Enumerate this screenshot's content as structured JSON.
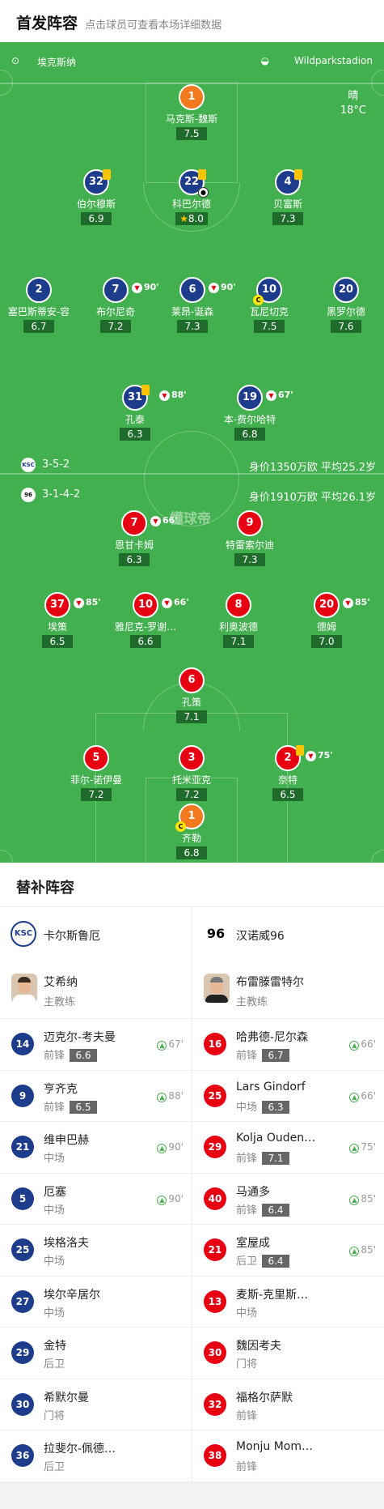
{
  "header": {
    "title": "首发阵容",
    "subtitle": "点击球员可查看本场详细数据"
  },
  "pitch": {
    "away_team": "埃克斯纳",
    "stadium": "Wildparkstadion",
    "weather": "晴",
    "temperature": "18°C",
    "watermark": "懂球帝",
    "home_formation": "3-5-2",
    "home_value": "身价1350万欧 平均25.2岁",
    "away_formation": "3-1-4-2",
    "away_value": "身价1910万欧 平均26.1岁",
    "home_players": [
      {
        "num": "1",
        "name": "马克斯-魏斯",
        "rating": "7.5"
      },
      {
        "num": "32",
        "name": "伯尔穆斯",
        "rating": "6.9"
      },
      {
        "num": "22",
        "name": "科巴尔德",
        "rating": "8.0"
      },
      {
        "num": "4",
        "name": "贝富斯",
        "rating": "7.3"
      },
      {
        "num": "2",
        "name": "塞巴斯蒂安-容",
        "rating": "6.7"
      },
      {
        "num": "7",
        "name": "布尔尼奇",
        "rating": "7.2",
        "sub": "90'"
      },
      {
        "num": "6",
        "name": "莱昂-诞森",
        "rating": "7.3",
        "sub": "90'"
      },
      {
        "num": "10",
        "name": "瓦尼切克",
        "rating": "7.5"
      },
      {
        "num": "20",
        "name": "黑罗尔德",
        "rating": "7.6"
      },
      {
        "num": "31",
        "name": "孔泰",
        "rating": "6.3",
        "sub": "88'"
      },
      {
        "num": "19",
        "name": "本-费尔哈特",
        "rating": "6.8",
        "sub": "67'"
      }
    ],
    "away_players": [
      {
        "num": "7",
        "name": "恩甘卡姆",
        "rating": "6.3",
        "sub": "66'"
      },
      {
        "num": "9",
        "name": "特雷索尔迪",
        "rating": "7.3"
      },
      {
        "num": "37",
        "name": "埃策",
        "rating": "6.5",
        "sub": "85'"
      },
      {
        "num": "10",
        "name": "雅尼克-罗谢…",
        "rating": "6.6",
        "sub": "66'"
      },
      {
        "num": "8",
        "name": "利奥波德",
        "rating": "7.1"
      },
      {
        "num": "20",
        "name": "德姆",
        "rating": "7.0",
        "sub": "85'"
      },
      {
        "num": "6",
        "name": "孔策",
        "rating": "7.1"
      },
      {
        "num": "5",
        "name": "菲尔-诺伊曼",
        "rating": "7.2"
      },
      {
        "num": "3",
        "name": "托米亚克",
        "rating": "7.2"
      },
      {
        "num": "2",
        "name": "奈特",
        "rating": "6.5",
        "sub": "75'"
      },
      {
        "num": "1",
        "name": "齐勒",
        "rating": "6.8"
      }
    ]
  },
  "subs": {
    "title": "替补阵容",
    "home": {
      "team": "卡尔斯鲁厄",
      "logo": "KSC",
      "coach": {
        "name": "艾希纳",
        "role": "主教练"
      },
      "players": [
        {
          "num": "14",
          "name": "迈克尔-考夫曼",
          "pos": "前锋",
          "rating": "6.6",
          "min": "67'"
        },
        {
          "num": "9",
          "name": "亨齐克",
          "pos": "前锋",
          "rating": "6.5",
          "min": "88'"
        },
        {
          "num": "21",
          "name": "维申巴赫",
          "pos": "中场",
          "rating": "",
          "min": "90'"
        },
        {
          "num": "5",
          "name": "厄塞",
          "pos": "中场",
          "rating": "",
          "min": "90'"
        },
        {
          "num": "25",
          "name": "埃格洛夫",
          "pos": "中场",
          "rating": "",
          "min": ""
        },
        {
          "num": "27",
          "name": "埃尔辛居尔",
          "pos": "中场",
          "rating": "",
          "min": ""
        },
        {
          "num": "29",
          "name": "金特",
          "pos": "后卫",
          "rating": "",
          "min": ""
        },
        {
          "num": "30",
          "name": "希默尔曼",
          "pos": "门将",
          "rating": "",
          "min": ""
        },
        {
          "num": "36",
          "name": "拉斐尔-佩德…",
          "pos": "后卫",
          "rating": "",
          "min": ""
        }
      ]
    },
    "away": {
      "team": "汉诺威96",
      "logo": "96",
      "coach": {
        "name": "布雷滕雷特尔",
        "role": "主教练"
      },
      "players": [
        {
          "num": "16",
          "name": "哈弗德-尼尔森",
          "pos": "前锋",
          "rating": "6.7",
          "min": "66'"
        },
        {
          "num": "25",
          "name": "Lars Gindorf",
          "pos": "中场",
          "rating": "6.3",
          "min": "66'"
        },
        {
          "num": "29",
          "name": "Kolja Oudenne",
          "pos": "前锋",
          "rating": "7.1",
          "min": "75'"
        },
        {
          "num": "40",
          "name": "马通多",
          "pos": "前锋",
          "rating": "6.4",
          "min": "85'"
        },
        {
          "num": "21",
          "name": "室屋成",
          "pos": "后卫",
          "rating": "6.4",
          "min": "85'"
        },
        {
          "num": "13",
          "name": "麦斯-克里斯…",
          "pos": "中场",
          "rating": "",
          "min": ""
        },
        {
          "num": "30",
          "name": "魏因考夫",
          "pos": "门将",
          "rating": "",
          "min": ""
        },
        {
          "num": "32",
          "name": "福格尔萨默",
          "pos": "前锋",
          "rating": "",
          "min": ""
        },
        {
          "num": "38",
          "name": "Monju Momuluh",
          "pos": "前锋",
          "rating": "",
          "min": ""
        }
      ]
    }
  }
}
